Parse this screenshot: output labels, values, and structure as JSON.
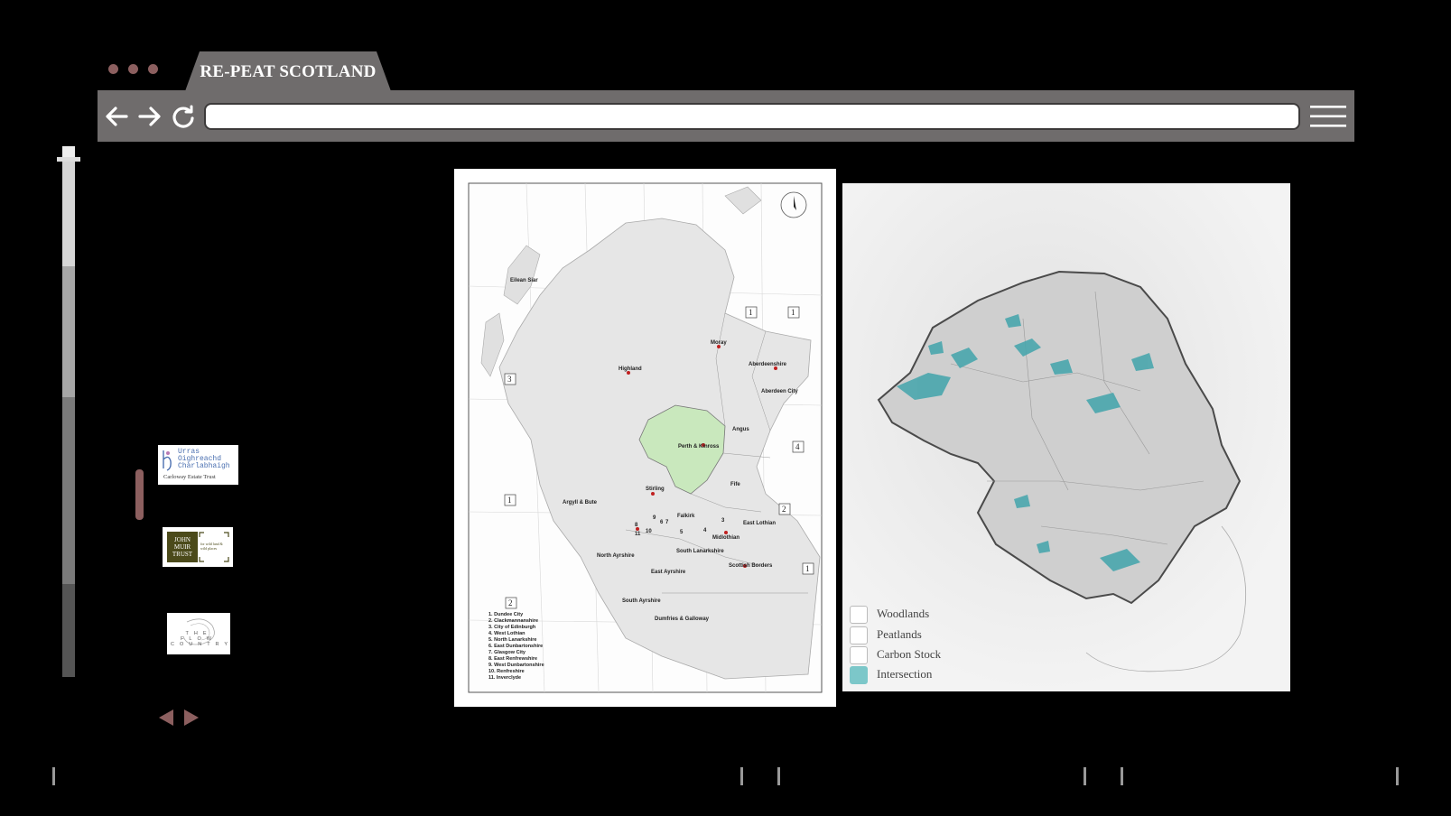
{
  "browser": {
    "tab_title": "RE-PEAT SCOTLAND",
    "url": "",
    "icons": [
      "back-arrow-icon",
      "forward-arrow-icon",
      "reload-icon",
      "hamburger-menu-icon"
    ]
  },
  "partners": [
    {
      "name": "Urras Oighreachd Chàrlabhaigh",
      "subtitle": "Carloway Estate Trust"
    },
    {
      "name": "JOHN MUIR TRUST",
      "subtitle": "for wild land & wild places"
    },
    {
      "name": "THE FLOW COUNTRY",
      "subtitle": ""
    }
  ],
  "map_scotland": {
    "regions": [
      "Eilean Siar",
      "Highland",
      "Moray",
      "Aberdeenshire",
      "Aberdeen City",
      "Angus",
      "Perth & Kinross",
      "Fife",
      "Stirling",
      "Argyll & Bute",
      "Falkirk",
      "East Lothian",
      "Midlothian",
      "South Lanarkshire",
      "North Ayrshire",
      "East Ayrshire",
      "Scottish Borders",
      "South Ayrshire",
      "Dumfries & Galloway"
    ],
    "box_numbers": [
      "1",
      "1",
      "3",
      "4",
      "1",
      "2",
      "1",
      "2"
    ],
    "inline_numbers": [
      "3",
      "7",
      "6",
      "5",
      "4",
      "8",
      "10",
      "11",
      "9"
    ],
    "list": [
      "1. Dundee City",
      "2. Clackmannanshire",
      "3. City of Edinburgh",
      "4. West Lothian",
      "5. North Lanarkshire",
      "6. East Dunbartonshire",
      "7. Glasgow City",
      "8. East Renfrewshire",
      "9. West Dunbartonshire",
      "10. Renfreshire",
      "11. Inverclyde"
    ]
  },
  "legend": {
    "items": [
      {
        "label": "Woodlands",
        "color": "#ffffff"
      },
      {
        "label": "Peatlands",
        "color": "#ffffff"
      },
      {
        "label": "Carbon Stock",
        "color": "#ffffff"
      },
      {
        "label": "Intersection",
        "color": "#7cc7c9"
      }
    ]
  },
  "colors": {
    "accent": "#8c5f5f",
    "chrome": "#6f6c6c",
    "highlight_region": "#c9e8bd",
    "intersection": "#4aa6ad"
  }
}
